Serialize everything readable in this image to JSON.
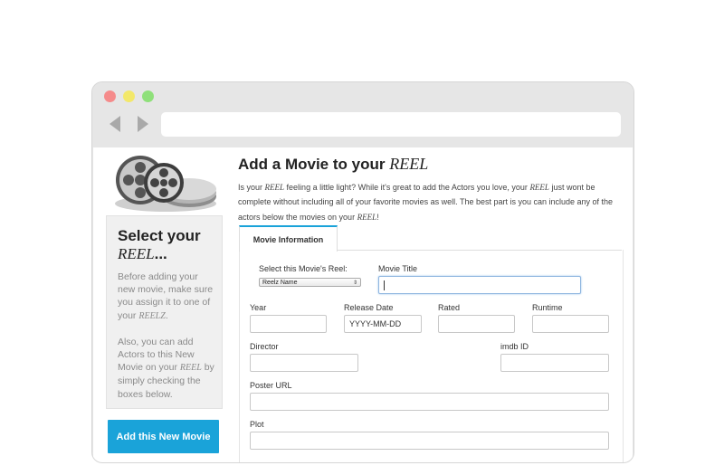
{
  "browser": {
    "url": ""
  },
  "sidebar": {
    "title_prefix": "Select your",
    "title_reel": "REEL",
    "title_suffix": "...",
    "p1_text": "Before adding your new movie, make sure you assign it to one of your",
    "p1_reelz": "REELZ",
    "p1_end": ".",
    "p2_text": "Also, you can add Actors to this New Movie on your",
    "p2_reel": "REEL",
    "p2_end": "by simply checking the boxes below.",
    "add_button": "Add this New Movie"
  },
  "main": {
    "title_prefix": "Add a Movie to your",
    "title_reel": "REEL",
    "intro_1": "Is your",
    "intro_reel1": "REEL",
    "intro_2": "feeling a little light? While it's great to add the Actors you love, your",
    "intro_reel2": "REEL",
    "intro_3": "just wont be complete without including all of your favorite movies as well. The best part is you can include any of the actors below the movies on your",
    "intro_reel3": "REEL",
    "intro_4": "!",
    "tab_label": "Movie Information"
  },
  "form": {
    "reel_select_label": "Select this Movie's Reel:",
    "reel_select_value": "Reelz Name",
    "movie_title_label": "Movie Title",
    "movie_title_value": "",
    "year_label": "Year",
    "release_date_label": "Release Date",
    "release_date_placeholder": "YYYY-MM-DD",
    "rated_label": "Rated",
    "runtime_label": "Runtime",
    "director_label": "Director",
    "imdb_label": "imdb ID",
    "poster_label": "Poster URL",
    "plot_label": "Plot"
  },
  "colors": {
    "accent": "#1aa3d9",
    "sidebar_bg": "#f0f0f0",
    "window_chrome": "#e6e6e6"
  }
}
